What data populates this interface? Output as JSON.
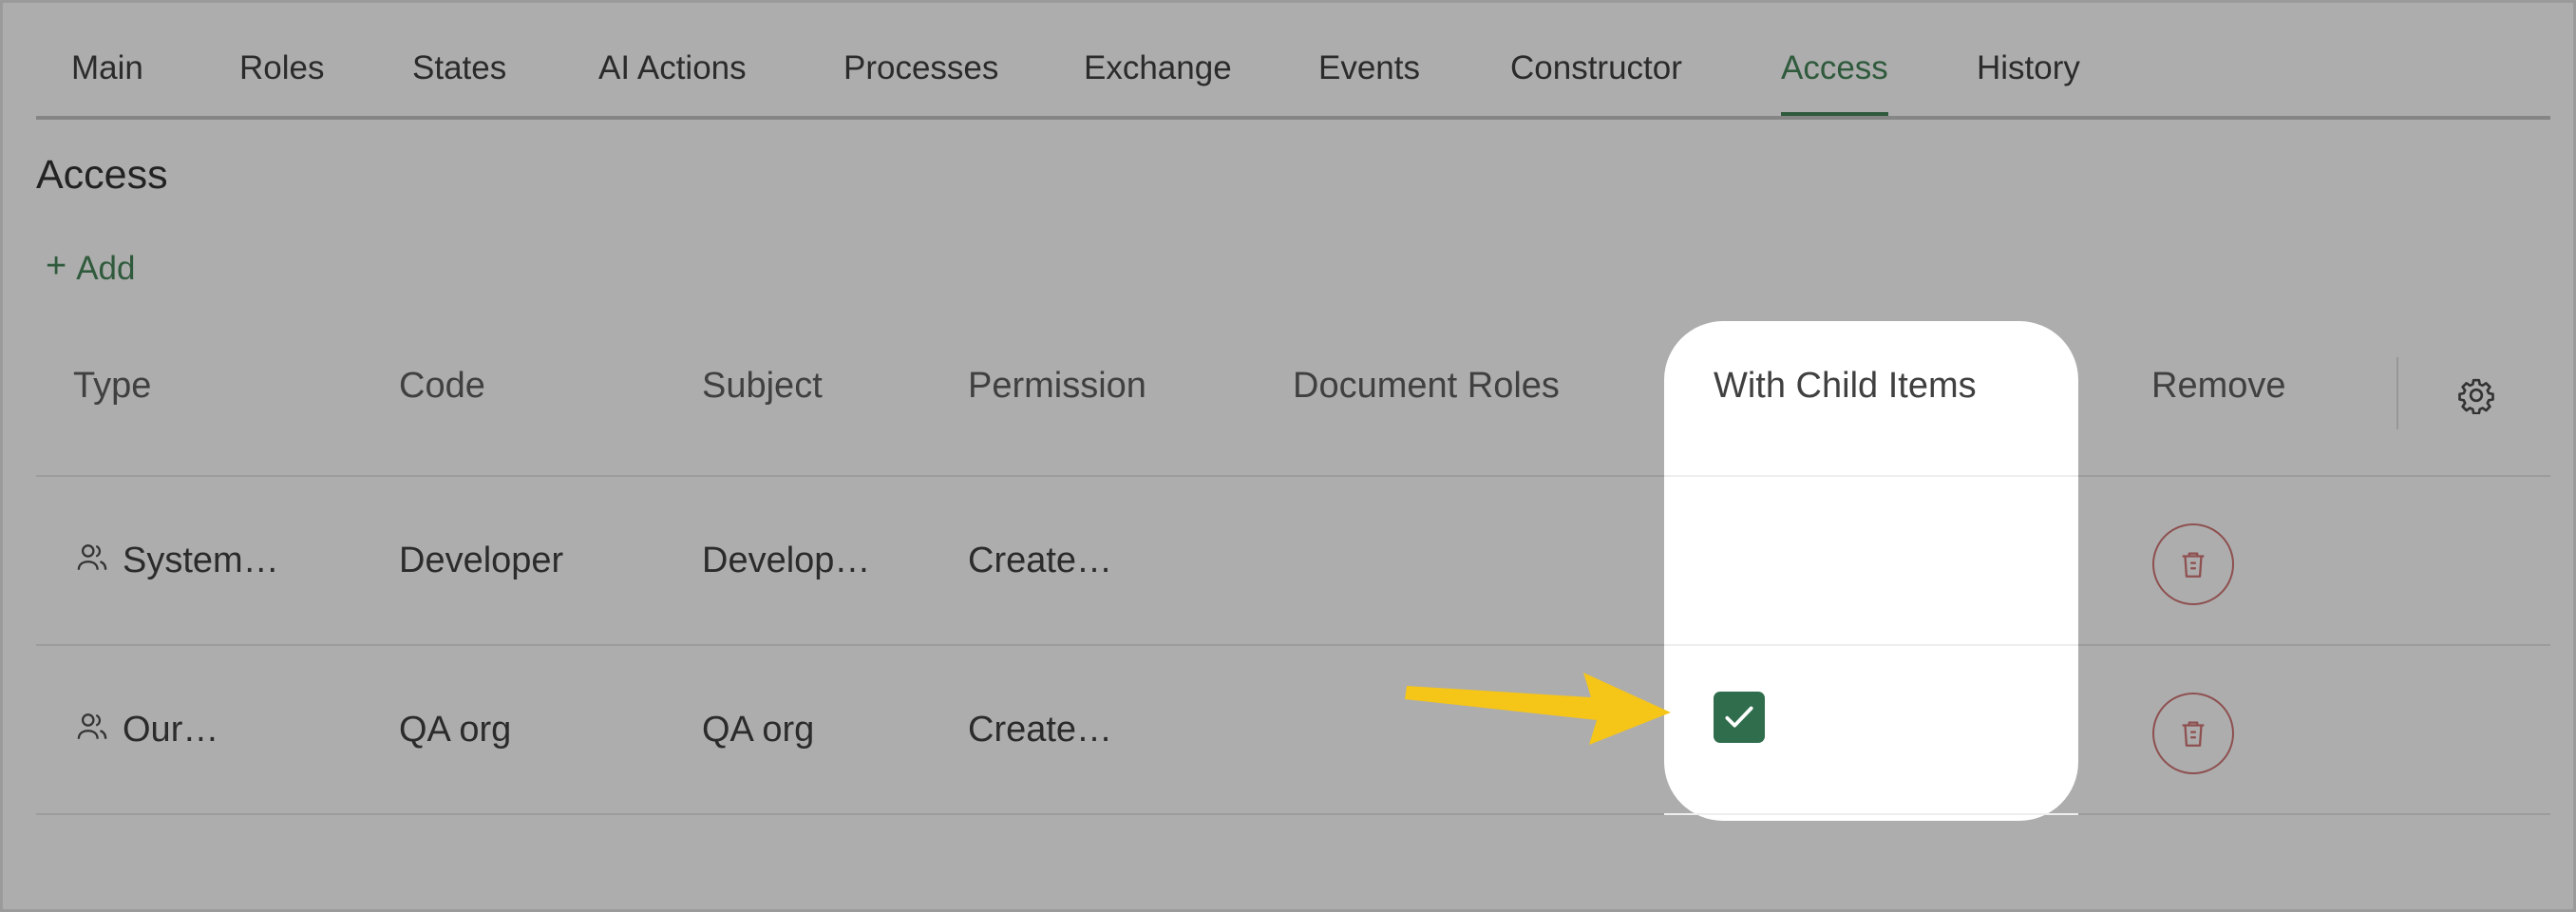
{
  "tabs": [
    {
      "label": "Main"
    },
    {
      "label": "Roles"
    },
    {
      "label": "States"
    },
    {
      "label": "AI Actions"
    },
    {
      "label": "Processes"
    },
    {
      "label": "Exchange"
    },
    {
      "label": "Events"
    },
    {
      "label": "Constructor"
    },
    {
      "label": "Access",
      "active": true
    },
    {
      "label": "History"
    }
  ],
  "page_title": "Access",
  "add_label": "Add",
  "table": {
    "columns": [
      "Type",
      "Code",
      "Subject",
      "Permission",
      "Document Roles",
      "With Child Items",
      "Remove"
    ],
    "rows": [
      {
        "type": "System…",
        "code": "Developer",
        "subject": "Develop…",
        "permission": "Create…",
        "document_roles": "",
        "with_child_items": false
      },
      {
        "type": "Our…",
        "code": "QA org",
        "subject": "QA org",
        "permission": "Create…",
        "document_roles": "",
        "with_child_items": true
      }
    ]
  },
  "colors": {
    "accent": "#2f5a3c",
    "checkbox": "#2f6d4c",
    "delete": "#8e4f4f",
    "annotation_arrow": "#f5c518"
  },
  "icons": [
    "user-group-icon",
    "trash-icon",
    "gear-icon",
    "checkmark-icon",
    "plus-icon"
  ]
}
